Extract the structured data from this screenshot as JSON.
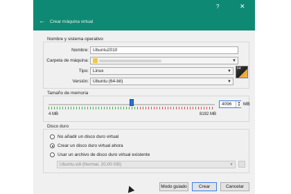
{
  "titlebar": {
    "help": "?",
    "close": "✕"
  },
  "header": {
    "back": "←",
    "title": "Crear máquina virtual"
  },
  "name_os": {
    "section_title": "Nombre y sistema operativo",
    "name_label": "Nombre:",
    "name_value": "Ubuntu2010",
    "folder_label": "Carpeta de máquina:",
    "type_label": "Tipo:",
    "type_value": "Linux",
    "version_label": "Versión:",
    "version_value": "Ubuntu (64-bit)",
    "os_icon_text": "64"
  },
  "memory": {
    "section_title": "Tamaño de memoria",
    "value": "4096",
    "unit": "MB",
    "min_label": "4 MB",
    "max_label": "8192 MB",
    "slider_fraction": 0.5
  },
  "disk": {
    "section_title": "Disco duro",
    "options": [
      {
        "label": "No añadir un disco duro virtual",
        "selected": false
      },
      {
        "label": "Crear un disco duro virtual ahora",
        "selected": true
      },
      {
        "label": "Usar un archivo de disco duro virtual existente",
        "selected": false
      }
    ],
    "existing_file": "Ubuntu.vdi (Normal, 20,00 GB)"
  },
  "buttons": {
    "guided": "Modo guiado",
    "create": "Crear",
    "cancel": "Cancelar"
  }
}
